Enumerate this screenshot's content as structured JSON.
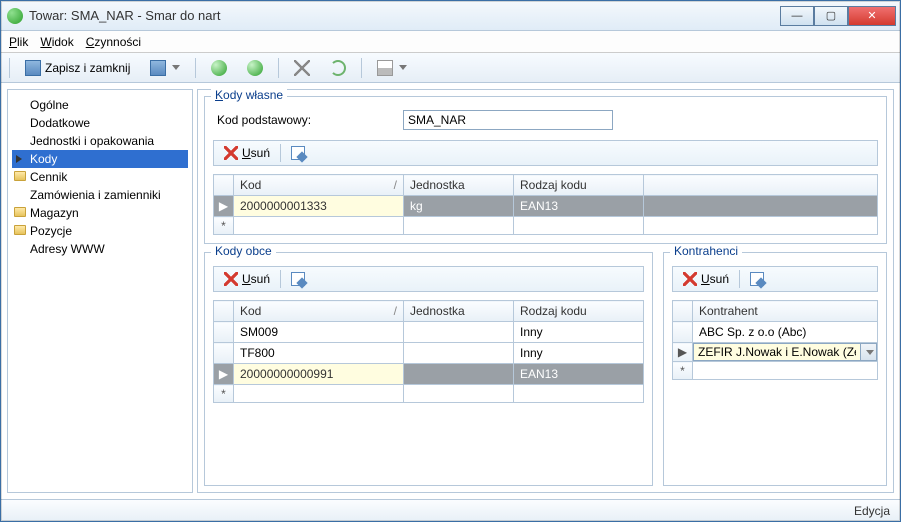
{
  "window": {
    "title": "Towar: SMA_NAR - Smar do nart"
  },
  "menu": {
    "file": "Plik",
    "view": "Widok",
    "actions": "Czynności"
  },
  "toolbar": {
    "save_close": "Zapisz i zamknij"
  },
  "sidebar": {
    "items": [
      "Ogólne",
      "Dodatkowe",
      "Jednostki i opakowania",
      "Kody",
      "Cennik",
      "Zamówienia i zamienniki",
      "Magazyn",
      "Pozycje",
      "Adresy WWW"
    ]
  },
  "own_codes": {
    "legend": "Kody własne",
    "basic_label": "Kod podstawowy:",
    "basic_value": "SMA_NAR",
    "delete_label": "Usuń",
    "columns": {
      "kod": "Kod",
      "jednostka": "Jednostka",
      "rodzaj": "Rodzaj kodu"
    },
    "rows": [
      {
        "kod": "2000000001333",
        "jednostka": "kg",
        "rodzaj": "EAN13"
      }
    ]
  },
  "foreign_codes": {
    "legend": "Kody obce",
    "delete_label": "Usuń",
    "columns": {
      "kod": "Kod",
      "jednostka": "Jednostka",
      "rodzaj": "Rodzaj kodu"
    },
    "rows": [
      {
        "kod": "SM009",
        "jednostka": "",
        "rodzaj": "Inny"
      },
      {
        "kod": "TF800",
        "jednostka": "",
        "rodzaj": "Inny"
      },
      {
        "kod": "20000000000991",
        "jednostka": "",
        "rodzaj": "EAN13"
      }
    ]
  },
  "contractors": {
    "legend": "Kontrahenci",
    "delete_label": "Usuń",
    "column": "Kontrahent",
    "rows": [
      "ABC Sp. z o.o (Abc)",
      "ZEFIR J.Nowak i E.Nowak (Zefir)"
    ]
  },
  "status": {
    "mode": "Edycja"
  }
}
